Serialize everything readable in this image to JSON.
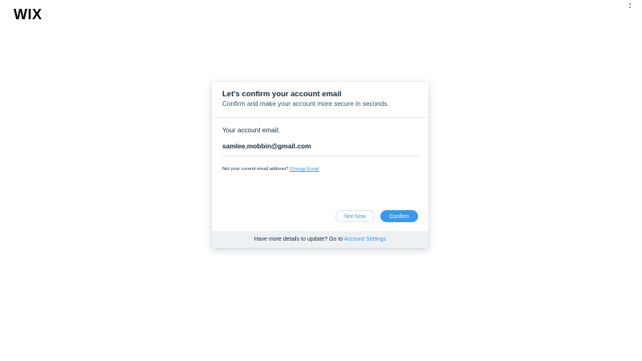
{
  "brand": {
    "logo_text": "WIX"
  },
  "dialog": {
    "title": "Let's confirm your account email",
    "subtitle": "Confirm and make your account more secure in seconds.",
    "email_label": "Your account email:",
    "email_value": "samlee.mobbin@gmail.com",
    "change_prompt": "Not your current email address?",
    "change_link": "Change Email",
    "secondary_button": "Not Now",
    "primary_button": "Confirm",
    "footer_text": "Have more details to update? Go to",
    "footer_link": "Account Settings"
  },
  "colors": {
    "accent": "#3899ec",
    "text": "#162d3d",
    "footer_bg": "#eef1f4"
  }
}
